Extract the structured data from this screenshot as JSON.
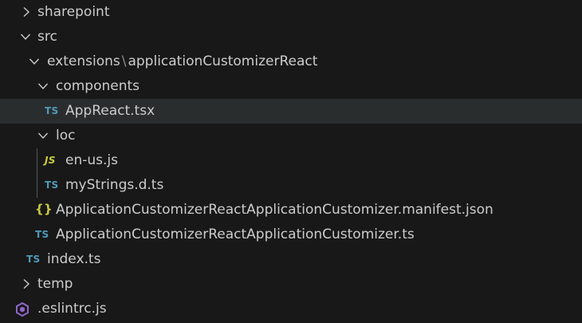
{
  "explorer": {
    "colors": {
      "background": "#181818",
      "selected_row": "#2a2d2e",
      "text": "#cccccc",
      "ts_icon": "#519aba",
      "js_icon": "#cbcb41",
      "eslint_icon": "#8f66c9"
    },
    "items": [
      {
        "label": "sharepoint",
        "type": "folder",
        "expanded": false
      },
      {
        "label": "src",
        "type": "folder",
        "expanded": true
      },
      {
        "label_part1": "extensions",
        "separator": "\\",
        "label_part2": "applicationCustomizerReact",
        "type": "folder",
        "expanded": true
      },
      {
        "label": "components",
        "type": "folder",
        "expanded": true
      },
      {
        "label": "AppReact.tsx",
        "type": "file",
        "icon": "TS",
        "selected": true
      },
      {
        "label": "loc",
        "type": "folder",
        "expanded": true
      },
      {
        "label": "en-us.js",
        "type": "file",
        "icon": "JS"
      },
      {
        "label": "myStrings.d.ts",
        "type": "file",
        "icon": "TS"
      },
      {
        "label": "ApplicationCustomizerReactApplicationCustomizer.manifest.json",
        "type": "file",
        "icon": "{}"
      },
      {
        "label": "ApplicationCustomizerReactApplicationCustomizer.ts",
        "type": "file",
        "icon": "TS"
      },
      {
        "label": "index.ts",
        "type": "file",
        "icon": "TS"
      },
      {
        "label": "temp",
        "type": "folder",
        "expanded": false
      },
      {
        "label": ".eslintrc.js",
        "type": "file",
        "icon": "eslint-icon"
      }
    ]
  }
}
